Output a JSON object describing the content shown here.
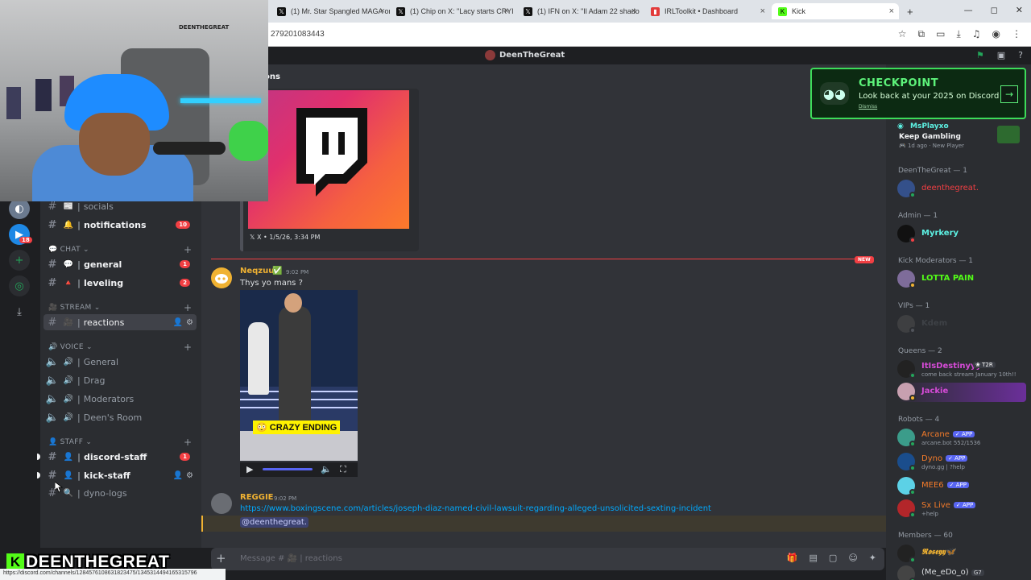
{
  "browser": {
    "tabs": [
      {
        "label": "(1) Mr. Star Spangled MAGA on",
        "icon": "x-logo-icon"
      },
      {
        "label": "(1) Chip on X: \"Lacy starts CRYI",
        "icon": "x-logo-icon"
      },
      {
        "label": "(1) IFN on X: \"Il Adam 22 shado",
        "icon": "x-logo-icon"
      },
      {
        "label": "IRLToolkit • Dashboard",
        "icon": "irltoolkit-icon"
      },
      {
        "label": "Kick",
        "icon": "kick-icon"
      }
    ],
    "new_tab": "+",
    "url_fragment": "279201083443",
    "window_controls": [
      "—",
      "◻",
      "✕"
    ],
    "status_url": "https://discord.com/channels/1284576108631823475/1345314494165315796"
  },
  "discord": {
    "window_title": "DeenTheGreat",
    "channel_header": "ons",
    "rail": {
      "badge": "18"
    },
    "categories": {
      "chat": "CHAT",
      "stream": "STREAM",
      "voice": "VOICE",
      "staff": "STAFF"
    },
    "channels": [
      {
        "name": "socials",
        "emoji": "📰",
        "badge": "",
        "state": "normal"
      },
      {
        "name": "notifications",
        "emoji": "🔔",
        "badge": "10",
        "state": "unread"
      },
      {
        "name": "general",
        "emoji": "💬",
        "badge": "1",
        "state": "unread"
      },
      {
        "name": "leveling",
        "emoji": "🔺",
        "badge": "2",
        "state": "unread"
      },
      {
        "name": "reactions",
        "emoji": "🎥",
        "badge": "",
        "state": "selected"
      },
      {
        "name": "General",
        "emoji": "🔊",
        "badge": "",
        "state": "voice"
      },
      {
        "name": "Drag",
        "emoji": "🔊",
        "badge": "",
        "state": "voice"
      },
      {
        "name": "Moderators",
        "emoji": "🔊",
        "badge": "",
        "state": "voice"
      },
      {
        "name": "Deen's Room",
        "emoji": "🔊",
        "badge": "",
        "state": "voice"
      },
      {
        "name": "discord-staff",
        "emoji": "👤",
        "badge": "1",
        "state": "unread"
      },
      {
        "name": "kick-staff",
        "emoji": "👤",
        "badge": "",
        "state": "hover"
      },
      {
        "name": "dyno-logs",
        "emoji": "🔍",
        "badge": "",
        "state": "normal"
      }
    ],
    "embed": {
      "footer": "X • 1/5/26, 3:34 PM"
    },
    "new_pill": "NEW",
    "messages": [
      {
        "author": "Neqzuu",
        "author_color": "#f0b232",
        "time": "9:02 PM",
        "text": "Thys yo mans ?",
        "video_caption": "CRAZY ENDING"
      },
      {
        "author": "REGGIE",
        "author_color": "#f0b232",
        "time": "9:02 PM",
        "link": "https://www.boxingscene.com/articles/joseph-diaz-named-civil-lawsuit-regarding-alleged-unsolicited-sexting-incident",
        "mention": "@deenthegreat."
      }
    ],
    "composer": {
      "placeholder": "Message # 🎥 | reactions"
    },
    "checkpoint": {
      "title": "CHECKPOINT",
      "subtitle": "Look back at your 2025 on Discord",
      "dismiss": "Dismiss"
    },
    "members": {
      "top": {
        "name": "MsPlayxo",
        "status": "Keep Gambling",
        "sub": "1d ago",
        "tag": "New Player"
      },
      "groups": [
        {
          "label": "DeenTheGreat — 1",
          "members": [
            {
              "name": "deenthegreat.",
              "color": "#f23f43",
              "sub": ""
            }
          ]
        },
        {
          "label": "Admin — 1",
          "members": [
            {
              "name": "Myrkery",
              "color": "#5df2e4",
              "sub": ""
            }
          ]
        },
        {
          "label": "Kick Moderators — 1",
          "members": [
            {
              "name": "LOTTA PAIN",
              "color": "#53fc18",
              "sub": ""
            }
          ]
        },
        {
          "label": "VIPs — 1",
          "members": [
            {
              "name": "Kdem",
              "color": "#555a60",
              "sub": ""
            }
          ]
        },
        {
          "label": "Queens — 2",
          "members": [
            {
              "name": "ItIsDestinyyy",
              "color": "#d54bd6",
              "sub": "come back stream January 10th!!",
              "tag": "T2R"
            },
            {
              "name": "Jackie",
              "color": "#d54bd6",
              "sub": ""
            }
          ]
        },
        {
          "label": "Robots — 4",
          "members": [
            {
              "name": "Arcane",
              "color": "#f47b2a",
              "sub": "arcane.bot 552/1536",
              "app": "APP"
            },
            {
              "name": "Dyno",
              "color": "#f47b2a",
              "sub": "dyno.gg | ?help",
              "app": "APP"
            },
            {
              "name": "MEE6",
              "color": "#f47b2a",
              "sub": "",
              "app": "APP"
            },
            {
              "name": "Sx Live",
              "color": "#f47b2a",
              "sub": "+help",
              "app": "APP"
            }
          ]
        },
        {
          "label": "Members — 60",
          "members": [
            {
              "name": "𝕽𝖔𝖘𝖊𝖞𝖞🦋",
              "color": "#f0b232",
              "sub": ""
            },
            {
              "name": "(Me_eDo_o)",
              "color": "#dbdee1",
              "sub": "",
              "tag": "G7"
            }
          ]
        }
      ]
    }
  },
  "stream_overlay": {
    "name": "DEENTHEGREAT",
    "cam_sign": "DEENTHEGREAT"
  },
  "colors": {
    "accent": "#5865f2",
    "kick_green": "#53fc18",
    "danger": "#f23f43"
  }
}
